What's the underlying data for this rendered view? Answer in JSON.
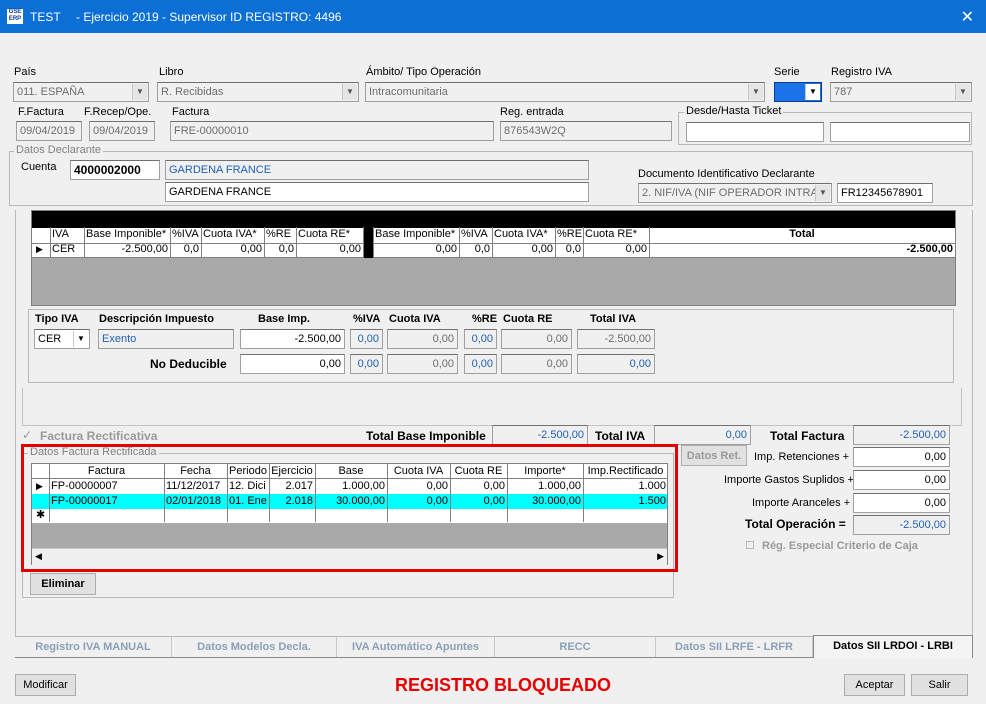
{
  "window": {
    "app": "TEST",
    "caption": "- Ejercicio 2019 - Supervisor ID REGISTRO: 4496",
    "close": "✕",
    "logo_top": "GSE",
    "logo_bottom": "ERP"
  },
  "header": {
    "pais_label": "País",
    "pais_value": "011.  ESPAÑA",
    "libro_label": "Libro",
    "libro_value": "R. Recibidas",
    "ambito_label": "Ámbito/ Tipo Operación",
    "ambito_value": "Intracomunitaria",
    "serie_label": "Serie",
    "registro_label": "Registro IVA",
    "registro_value": "787",
    "ffactura_label": "F.Factura",
    "ffactura_value": "09/04/2019",
    "frecep_label": "F.Recep/Ope.",
    "frecep_value": "09/04/2019",
    "factura_label": "Factura",
    "factura_value": "FRE-00000010",
    "regentrada_label": "Reg. entrada",
    "regentrada_value": "876543W2Q",
    "ticket_label": "Desde/Hasta Ticket"
  },
  "declarante": {
    "group": "Datos Declarante",
    "cuenta_label": "Cuenta",
    "cuenta_value": "4000002000",
    "name_blue": "GARDENA FRANCE",
    "name": "GARDENA FRANCE",
    "doc_label": "Documento Identificativo Declarante",
    "doc_type": "2. NIF/IVA (NIF OPERADOR INTRA",
    "doc_value": "FR12345678901"
  },
  "iva_grid": {
    "headers": [
      "IVA",
      "Base Imponible*",
      "%IVA",
      "Cuota IVA*",
      "%RE",
      "Cuota RE*",
      "Base Imponible*",
      "%IVA",
      "Cuota IVA*",
      "%RE",
      "Cuota RE*",
      "Total"
    ],
    "row": [
      "CER",
      "-2.500,00",
      "0,0",
      "0,00",
      "0,0",
      "0,00",
      "0,00",
      "0,0",
      "0,00",
      "0,0",
      "0,00",
      "-2.500,00"
    ]
  },
  "detail": {
    "h_tipo": "Tipo IVA",
    "h_desc": "Descripción Impuesto",
    "h_base": "Base Imp.",
    "h_piva": "%IVA",
    "h_cuota": "Cuota IVA",
    "h_pre": "%RE",
    "h_cuotare": "Cuota RE",
    "h_total": "Total IVA",
    "tipo": "CER",
    "desc": "Exento",
    "base": "-2.500,00",
    "piva": "0,00",
    "cuota": "0,00",
    "pre": "0,00",
    "cuotare": "0,00",
    "total": "-2.500,00",
    "nodeducible_label": "No  Deducible",
    "nd_base": "0,00",
    "nd_piva": "0,00",
    "nd_cuota": "0,00",
    "nd_pre": "0,00",
    "nd_cuotare": "0,00",
    "nd_total": "0,00"
  },
  "totals": {
    "rectificativa_label": "Factura Rectificativa",
    "check": "✓",
    "base_label": "Total Base Imponible",
    "base_value": "-2.500,00",
    "iva_label": "Total IVA",
    "iva_value": "0,00",
    "factura_label": "Total Factura",
    "factura_value": "-2.500,00",
    "datosret_label": "Datos Ret.",
    "retenciones_label": "Imp. Retenciones +",
    "retenciones_value": "0,00",
    "gastos_label": "Importe Gastos Suplidos +",
    "gastos_value": "0,00",
    "aranceles_label": "Importe Aranceles +",
    "aranceles_value": "0,00",
    "operacion_label": "Total Operación =",
    "operacion_value": "-2.500,00",
    "caja_label": "Rég. Especial Criterio de Caja"
  },
  "rect": {
    "group": "Datos Factura Rectificada",
    "headers": [
      "Factura",
      "Fecha",
      "Periodo",
      "Ejercicio",
      "Base",
      "Cuota IVA",
      "Cuota RE",
      "Importe*",
      "Imp.Rectificado"
    ],
    "rows": [
      [
        "FP-00000007",
        "11/12/2017",
        "12. Dici",
        "2.017",
        "1.000,00",
        "0,00",
        "0,00",
        "1.000,00",
        "1.000"
      ],
      [
        "FP-00000017",
        "02/01/2018",
        "01. Ene",
        "2.018",
        "30.000,00",
        "0,00",
        "0,00",
        "30.000,00",
        "1.500"
      ]
    ],
    "new_row_marker": "✱",
    "eliminar": "Eliminar"
  },
  "tabs": [
    "Registro IVA MANUAL",
    "Datos Modelos Decla.",
    "IVA Automático Apuntes",
    "RECC",
    "Datos SII  LRFE - LRFR",
    "Datos SII LRDOI - LRBI"
  ],
  "footer": {
    "modificar": "Modificar",
    "status": "REGISTRO BLOQUEADO",
    "aceptar": "Aceptar",
    "salir": "Salir"
  },
  "colors": {
    "titlebar": "#0b6fd6",
    "highlight_row": "#00ffff",
    "alert": "#e60000",
    "value_blue": "#1f5fb4"
  }
}
